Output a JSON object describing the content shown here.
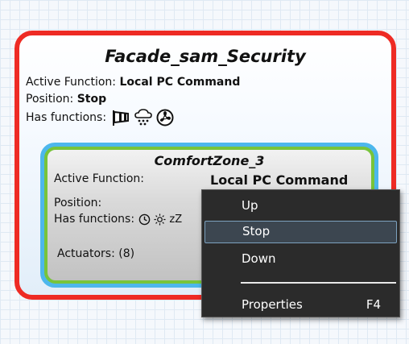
{
  "outer_block": {
    "title": "Facade_sam_Security",
    "active_function_label": "Active Function:",
    "active_function_value": "Local PC Command",
    "position_label": "Position:",
    "position_value": "Stop",
    "has_functions_label": "Has functions:",
    "function_icons": [
      "wind-icon",
      "rain-icon",
      "fan-icon"
    ],
    "border_color": "#ee2b24"
  },
  "inner_block": {
    "title": "ComfortZone_3",
    "active_function_label": "Active Function:",
    "active_function_value": "Local PC Command",
    "position_label": "Position:",
    "has_functions_label": "Has functions:",
    "function_icons": [
      "clock-icon",
      "sun-icon",
      "sleep-icon"
    ],
    "sleep_glyph": "zZ",
    "actuators_label": "Actuators: (8)",
    "border_color_outer": "#4db7ec",
    "border_color_inner": "#78c43a"
  },
  "context_menu": {
    "items": [
      {
        "label": "Up",
        "shortcut": ""
      },
      {
        "label": "Stop",
        "shortcut": "",
        "highlighted": true
      },
      {
        "label": "Down",
        "shortcut": ""
      },
      {
        "label": "Properties",
        "shortcut": "F4"
      }
    ]
  }
}
